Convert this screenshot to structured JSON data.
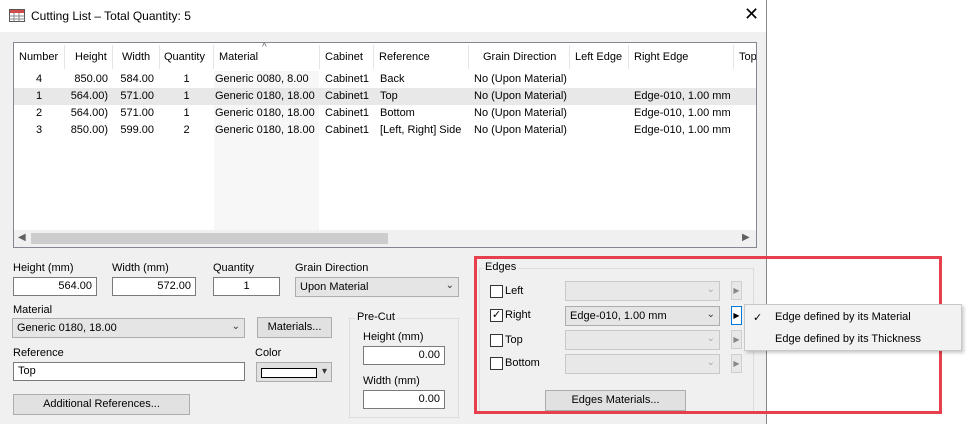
{
  "window": {
    "title": "Cutting List – Total Quantity: 5",
    "close": "✕"
  },
  "list": {
    "columns": [
      "Number",
      "Height",
      "Width",
      "Quantity",
      "Material",
      "Cabinet",
      "Reference",
      "Grain Direction",
      "Left Edge",
      "Right Edge",
      "Top"
    ],
    "rows": [
      {
        "number": "4",
        "height": "850.00",
        "width": "584.00",
        "quantity": "1",
        "material": "Generic 0080, 8.00",
        "cabinet": "Cabinet1",
        "reference": "Back",
        "grain": "No (Upon Material)",
        "left_edge": "",
        "right_edge": ""
      },
      {
        "number": "1",
        "height": "564.00)",
        "width": "571.00",
        "quantity": "1",
        "material": "Generic 0180, 18.00",
        "cabinet": "Cabinet1",
        "reference": "Top",
        "grain": "No (Upon Material)",
        "left_edge": "",
        "right_edge": "Edge-010, 1.00 mm"
      },
      {
        "number": "2",
        "height": "564.00)",
        "width": "571.00",
        "quantity": "1",
        "material": "Generic 0180, 18.00",
        "cabinet": "Cabinet1",
        "reference": "Bottom",
        "grain": "No (Upon Material)",
        "left_edge": "",
        "right_edge": "Edge-010, 1.00 mm"
      },
      {
        "number": "3",
        "height": "850.00)",
        "width": "599.00",
        "quantity": "2",
        "material": "Generic 0180, 18.00",
        "cabinet": "Cabinet1",
        "reference": "[Left, Right] Side",
        "grain": "No (Upon Material)",
        "left_edge": "",
        "right_edge": "Edge-010, 1.00 mm"
      }
    ],
    "scroll_left": "◀",
    "scroll_right": "▶"
  },
  "form": {
    "height_label": "Height (mm)",
    "height_value": "564.00",
    "width_label": "Width (mm)",
    "width_value": "572.00",
    "quantity_label": "Quantity",
    "quantity_value": "1",
    "grain_label": "Grain Direction",
    "grain_value": "Upon Material",
    "material_label": "Material",
    "material_value": "Generic 0180, 18.00",
    "materials_button": "Materials...",
    "reference_label": "Reference",
    "reference_value": "Top",
    "color_label": "Color",
    "additional_references_button": "Additional References...",
    "precut": {
      "title": "Pre-Cut",
      "height_label": "Height (mm)",
      "height_value": "0.00",
      "width_label": "Width (mm)",
      "width_value": "0.00"
    }
  },
  "edges": {
    "title": "Edges",
    "left": {
      "label": "Left",
      "checked": false,
      "value": ""
    },
    "right": {
      "label": "Right",
      "checked": true,
      "value": "Edge-010, 1.00 mm"
    },
    "top": {
      "label": "Top",
      "checked": false,
      "value": ""
    },
    "bottom": {
      "label": "Bottom",
      "checked": false,
      "value": ""
    },
    "materials_button": "Edges Materials..."
  },
  "context_menu": {
    "items": [
      {
        "label": "Edge defined by its Material",
        "checked": true
      },
      {
        "label": "Edge defined by its Thickness",
        "checked": false
      }
    ],
    "check_glyph": "✓"
  },
  "colors": {
    "highlight": "#e6404f",
    "selected_row": "#e8e8e8",
    "focus_border": "#0078d7"
  }
}
